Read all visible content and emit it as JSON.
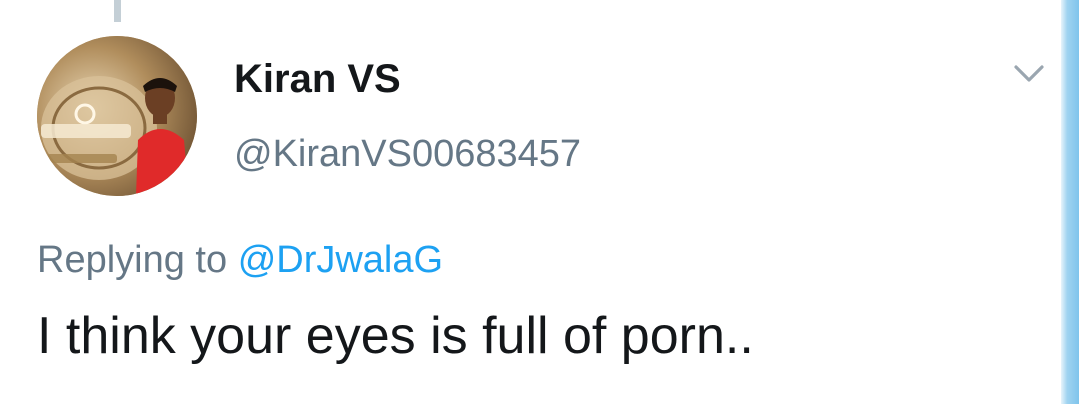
{
  "tweet": {
    "author": {
      "display_name": "Kiran VS",
      "handle": "@KiranVS00683457"
    },
    "reply": {
      "prefix": "Replying to",
      "mention": "@DrJwalaG"
    },
    "text": "I think your eyes is full of porn.."
  },
  "colors": {
    "secondary_text": "#657786",
    "link": "#1da1f2",
    "primary_text": "#14171a"
  },
  "icons": {
    "menu": "chevron-down-icon"
  }
}
